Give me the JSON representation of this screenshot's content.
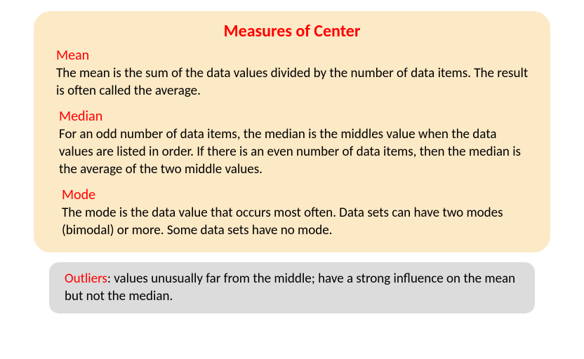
{
  "title": "Measures of Center",
  "sections": [
    {
      "heading": "Mean",
      "body": "The mean is the sum of the data values divided by the number of data items. The result is often called the average."
    },
    {
      "heading": "Median",
      "body": "For an odd number of data items, the median is the middles value when the data values are listed in order. If there is an even number of data items, then the median is the average of the two middle values."
    },
    {
      "heading": "Mode",
      "body": "The mode is the data value that occurs most often. Data sets can have two modes (bimodal) or more. Some data sets have no mode."
    }
  ],
  "outlier": {
    "label": "Outliers",
    "text": ": values unusually far from the middle; have a strong influence on the mean but not the median."
  }
}
